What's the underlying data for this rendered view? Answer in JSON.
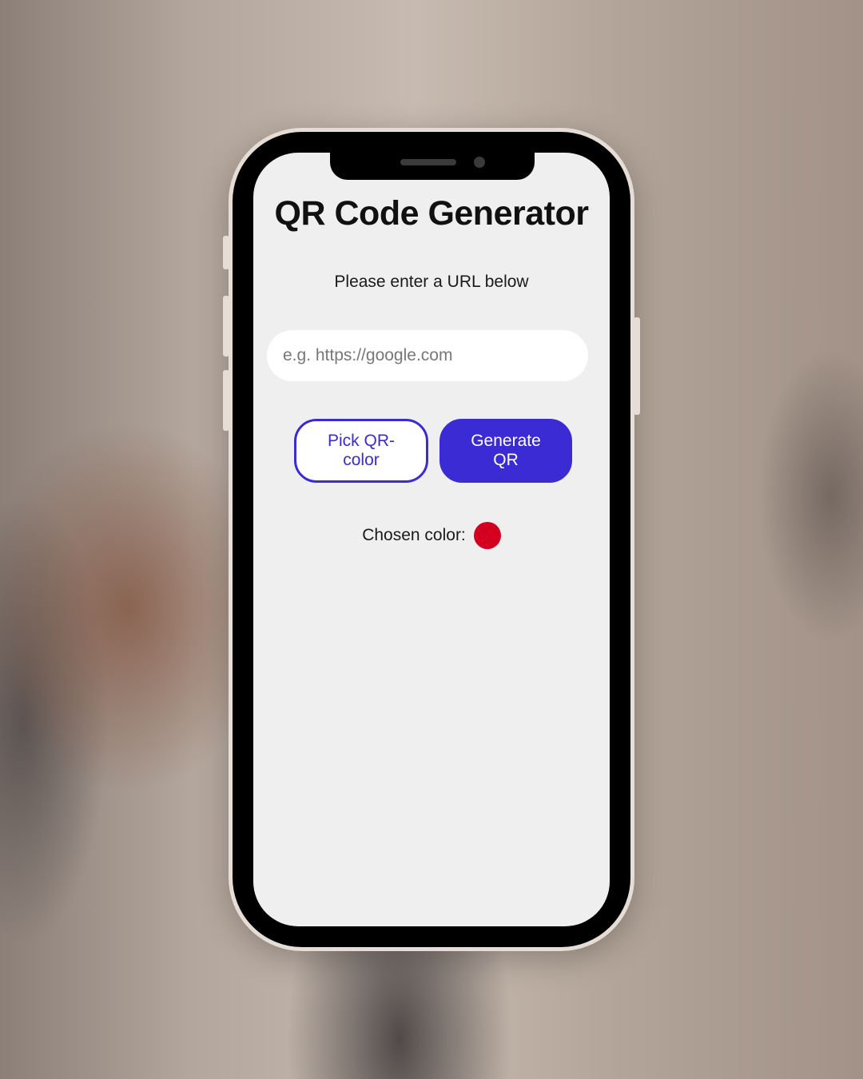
{
  "app": {
    "title": "QR Code Generator",
    "subtitle": "Please enter a URL below"
  },
  "url_input": {
    "value": "",
    "placeholder": "e.g. https://google.com"
  },
  "buttons": {
    "pick_color_label": "Pick QR-color",
    "generate_label": "Generate QR"
  },
  "chosen_color": {
    "label": "Chosen color:",
    "value": "#d40020"
  },
  "colors": {
    "accent": "#3a2bd4",
    "screen_background": "#efefef"
  }
}
